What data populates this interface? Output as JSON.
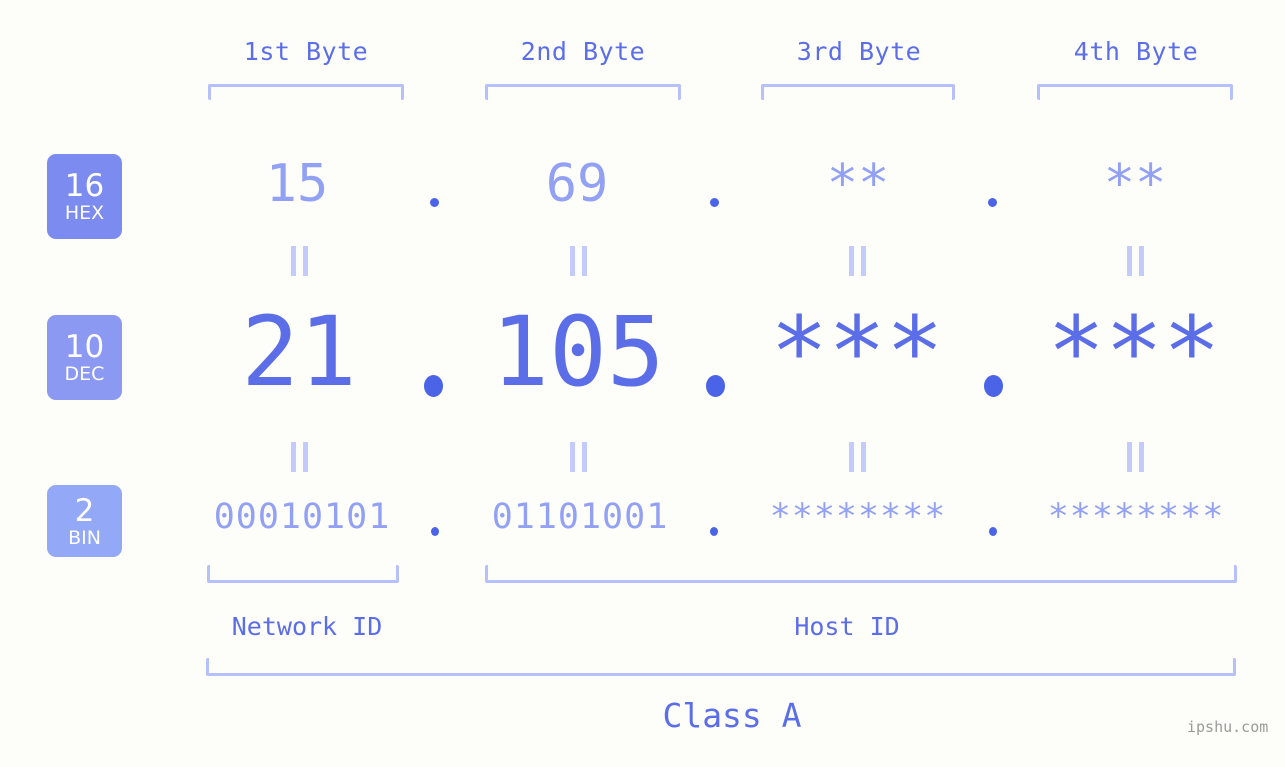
{
  "background_color": "#fdfefa",
  "accent_color": "#5b6ee8",
  "accent_light_color": "#93a1f5",
  "bracket_color": "#b6c0fb",
  "byte_headers": [
    {
      "label": "1st Byte"
    },
    {
      "label": "2nd Byte"
    },
    {
      "label": "3rd Byte"
    },
    {
      "label": "4th Byte"
    }
  ],
  "rows": {
    "hex": {
      "badge_number": "16",
      "badge_unit": "HEX",
      "badge_color": "#7b8bef",
      "values": [
        "15",
        "69",
        "**",
        "**"
      ]
    },
    "dec": {
      "badge_number": "10",
      "badge_unit": "DEC",
      "badge_color": "#8b99f2",
      "values": [
        "21",
        "105",
        "***",
        "***"
      ]
    },
    "bin": {
      "badge_number": "2",
      "badge_unit": "BIN",
      "badge_color": "#93a8f6",
      "values": [
        "00010101",
        "01101001",
        "********",
        "********"
      ]
    }
  },
  "separator": ".",
  "equals_mark": "=",
  "id_labels": {
    "network": "Network ID",
    "host": "Host ID"
  },
  "class_label": "Class A",
  "watermark": "ipshu.com"
}
